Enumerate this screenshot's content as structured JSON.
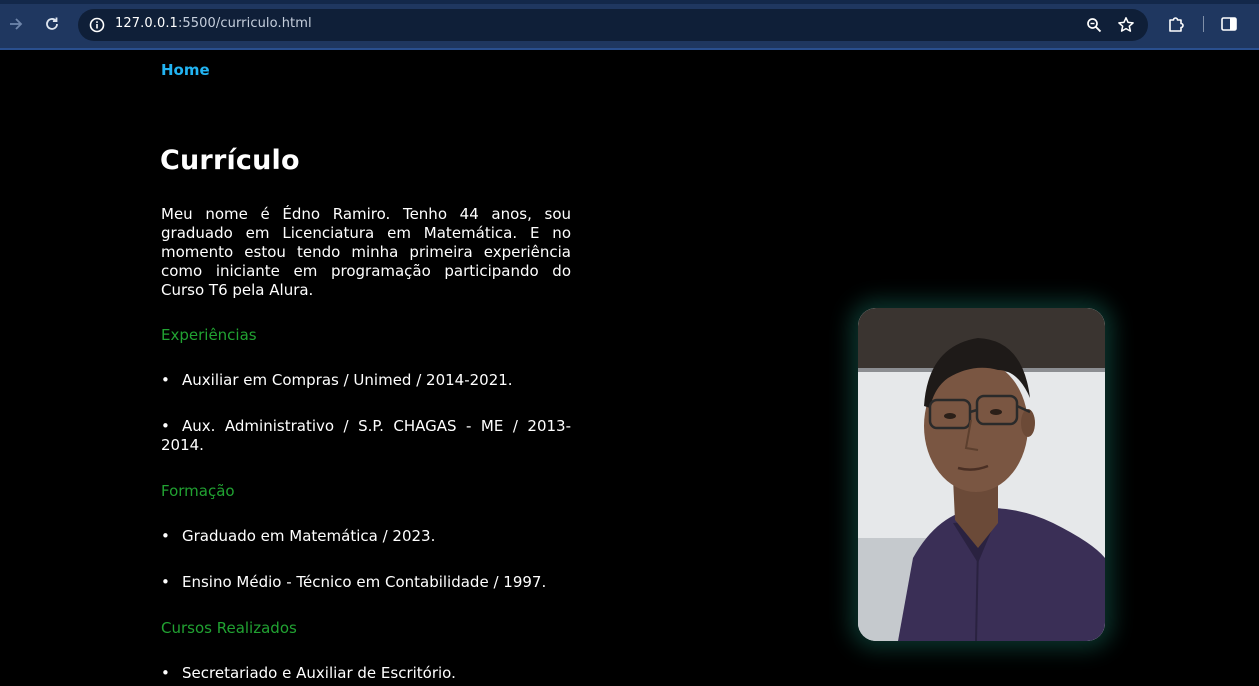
{
  "browser": {
    "url_host": "127.0.0.1",
    "url_rest": ":5500/curriculo.html",
    "icons": [
      "forward-icon",
      "reload-icon",
      "site-info-icon",
      "zoom-icon",
      "bookmark-star-icon",
      "extensions-icon",
      "side-panel-icon"
    ]
  },
  "nav": {
    "home": "Home"
  },
  "content": {
    "title": "Currículo",
    "intro": "Meu nome é Édno Ramiro. Tenho 44 anos, sou graduado em Licenciatura em Matemática. E no momento estou tendo minha primeira experiência como iniciante em programação participando do Curso T6 pela Alura.",
    "sections": {
      "experiencias": {
        "title": "Experiências",
        "items": [
          "Auxiliar em Compras / Unimed / 2014-2021.",
          "Aux. Administrativo / S.P. CHAGAS - ME / 2013-2014."
        ]
      },
      "formacao": {
        "title": "Formação",
        "items": [
          "Graduado em Matemática / 2023.",
          "Ensino Médio - Técnico em Contabilidade / 1997."
        ]
      },
      "cursos": {
        "title": "Cursos Realizados",
        "items": [
          "Secretariado e Auxiliar de Escritório."
        ]
      }
    }
  },
  "colors": {
    "background": "#000000",
    "link": "#22b4f2",
    "section_title": "#21a232",
    "photo_glow": "#145c50"
  }
}
